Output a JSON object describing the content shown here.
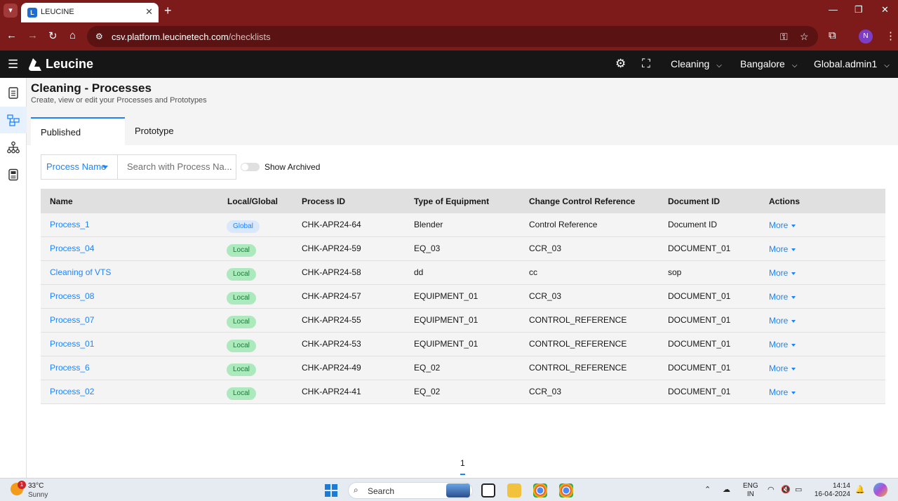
{
  "browser": {
    "tab_title": "LEUCINE",
    "url_host": "csv.platform.leucinetech.com",
    "url_path": "/checklists",
    "profile_initial": "N"
  },
  "header": {
    "brand": "Leucine",
    "use_case": "Cleaning",
    "facility": "Bangalore",
    "user": "Global.admin1"
  },
  "page": {
    "title": "Cleaning - Processes",
    "subtitle": "Create, view or edit your Processes and Prototypes",
    "tabs": [
      "Published",
      "Prototype"
    ]
  },
  "filters": {
    "field_selector": "Process Name",
    "search_placeholder": "Search with Process Na...",
    "show_archived_label": "Show Archived",
    "show_archived": false
  },
  "table": {
    "columns": [
      "Name",
      "Local/Global",
      "Process ID",
      "Type of Equipment",
      "Change Control Reference",
      "Document ID",
      "Actions"
    ],
    "rows": [
      {
        "name": "Process_1",
        "scope": "Global",
        "process_id": "CHK-APR24-64",
        "equipment": "Blender",
        "ccr": "Control Reference",
        "doc_id": "Document ID",
        "action": "More"
      },
      {
        "name": "Process_04",
        "scope": "Local",
        "process_id": "CHK-APR24-59",
        "equipment": "EQ_03",
        "ccr": "CCR_03",
        "doc_id": "DOCUMENT_01",
        "action": "More"
      },
      {
        "name": "Cleaning of VTS",
        "scope": "Local",
        "process_id": "CHK-APR24-58",
        "equipment": "dd",
        "ccr": "cc",
        "doc_id": "sop",
        "action": "More"
      },
      {
        "name": "Process_08",
        "scope": "Local",
        "process_id": "CHK-APR24-57",
        "equipment": "EQUIPMENT_01",
        "ccr": "CCR_03",
        "doc_id": "DOCUMENT_01",
        "action": "More"
      },
      {
        "name": "Process_07",
        "scope": "Local",
        "process_id": "CHK-APR24-55",
        "equipment": "EQUIPMENT_01",
        "ccr": "CONTROL_REFERENCE",
        "doc_id": "DOCUMENT_01",
        "action": "More"
      },
      {
        "name": "Process_01",
        "scope": "Local",
        "process_id": "CHK-APR24-53",
        "equipment": "EQUIPMENT_01",
        "ccr": "CONTROL_REFERENCE",
        "doc_id": "DOCUMENT_01",
        "action": "More"
      },
      {
        "name": "Process_6",
        "scope": "Local",
        "process_id": "CHK-APR24-49",
        "equipment": "EQ_02",
        "ccr": "CONTROL_REFERENCE",
        "doc_id": "DOCUMENT_01",
        "action": "More"
      },
      {
        "name": "Process_02",
        "scope": "Local",
        "process_id": "CHK-APR24-41",
        "equipment": "EQ_02",
        "ccr": "CCR_03",
        "doc_id": "DOCUMENT_01",
        "action": "More"
      }
    ]
  },
  "pagination": {
    "current_page": "1"
  },
  "taskbar": {
    "weather_alert": "1",
    "temperature": "33°C",
    "weather": "Sunny",
    "search_label": "Search",
    "lang_line1": "ENG",
    "lang_line2": "IN",
    "time": "14:14",
    "date": "16-04-2024"
  },
  "colors": {
    "accent": "#1d84ff",
    "browser_frame": "#7d1a1a",
    "app_header": "#161616",
    "badge_local_bg": "#ace9bc",
    "badge_global_bg": "#dbe8fb"
  }
}
